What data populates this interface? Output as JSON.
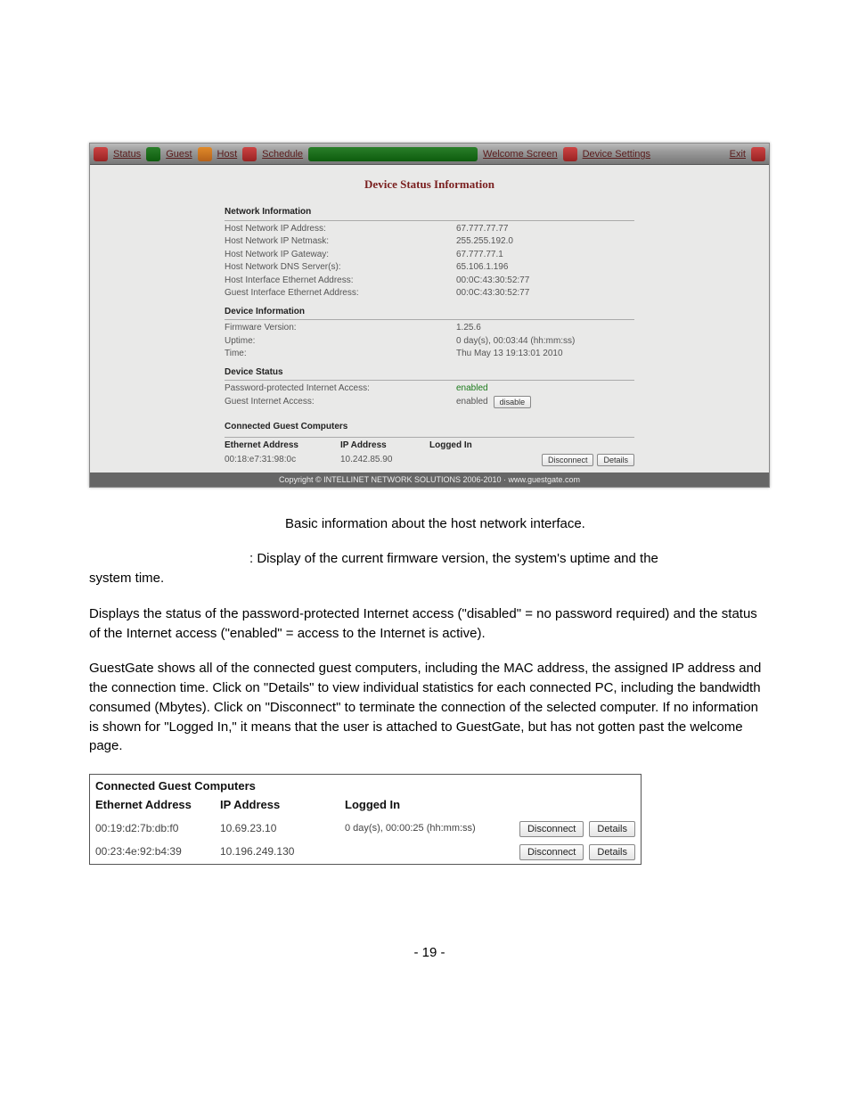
{
  "nav": {
    "status": "Status",
    "guest": "Guest",
    "host": "Host",
    "schedule": "Schedule",
    "welcome": "Welcome Screen",
    "device": "Device Settings",
    "exit": "Exit"
  },
  "panel": {
    "title": "Device Status Information",
    "network_info_head": "Network Information",
    "host_ip_label": "Host Network IP Address:",
    "host_ip_value": "67.777.77.77",
    "netmask_label": "Host Network IP Netmask:",
    "netmask_value": "255.255.192.0",
    "gateway_label": "Host Network IP Gateway:",
    "gateway_value": "67.777.77.1",
    "dns_label": "Host Network DNS Server(s):",
    "dns_value": "65.106.1.196",
    "host_eth_label": "Host Interface Ethernet Address:",
    "host_eth_value": "00:0C:43:30:52:77",
    "guest_eth_label": "Guest Interface Ethernet Address:",
    "guest_eth_value": "00:0C:43:30:52:77",
    "device_info_head": "Device Information",
    "fw_label": "Firmware Version:",
    "fw_value": "1.25.6",
    "uptime_label": "Uptime:",
    "uptime_value": "0 day(s), 00:03:44 (hh:mm:ss)",
    "time_label": "Time:",
    "time_value": "Thu May 13 19:13:01 2010",
    "device_status_head": "Device Status",
    "pp_label": "Password-protected Internet Access:",
    "pp_value": "enabled",
    "gia_label": "Guest Internet Access:",
    "gia_value": "enabled",
    "disable_btn": "disable",
    "cgc_head": "Connected Guest Computers",
    "col_eth": "Ethernet Address",
    "col_ip": "IP Address",
    "col_li": "Logged In",
    "g_eth": "00:18:e7:31:98:0c",
    "g_ip": "10.242.85.90",
    "disconnect_btn": "Disconnect",
    "details_btn": "Details",
    "copyright": "Copyright © INTELLINET NETWORK SOLUTIONS 2006-2010 · www.guestgate.com"
  },
  "doc": {
    "p1": "Basic information about the host network interface.",
    "p2a": ": Display of the current firmware version, the system's uptime and the",
    "p2b": "system time.",
    "p3": "Displays the status of the password-protected Internet access (\"disabled\" = no password required) and the status of the Internet access (\"enabled\" = access to the Internet is active).",
    "p4": "GuestGate shows all of the connected guest computers, including the MAC address, the assigned IP address and the connection time. Click on \"Details\" to view individual statistics for each connected PC, including the bandwidth consumed (Mbytes). Click on \"Disconnect\" to terminate the connection of the selected computer. If no information is shown for \"Logged In,\" it means that the user is attached to GuestGate, but has not gotten past the welcome page."
  },
  "cg": {
    "title": "Connected Guest Computers",
    "col_eth": "Ethernet Address",
    "col_ip": "IP Address",
    "col_li": "Logged In",
    "rows": [
      {
        "eth": "00:19:d2:7b:db:f0",
        "ip": "10.69.23.10",
        "logged": "0 day(s), 00:00:25 (hh:mm:ss)"
      },
      {
        "eth": "00:23:4e:92:b4:39",
        "ip": "10.196.249.130",
        "logged": ""
      }
    ],
    "disconnect": "Disconnect",
    "details": "Details"
  },
  "page_number": "- 19 -"
}
